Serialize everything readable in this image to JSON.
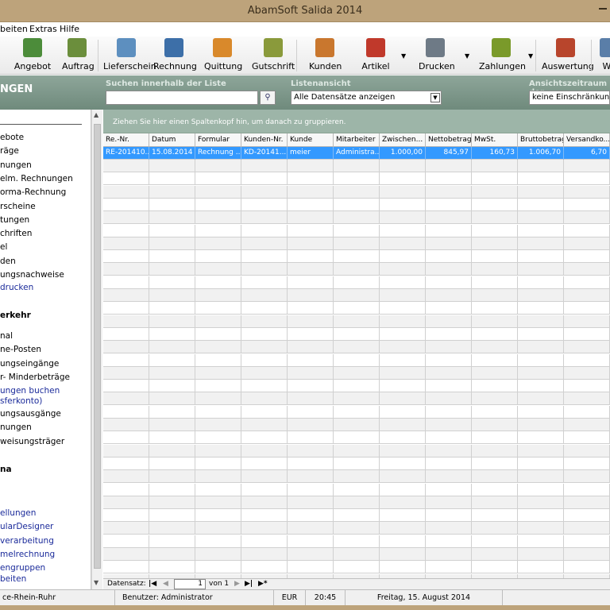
{
  "window": {
    "title": "AbamSoft Salida 2014"
  },
  "menu": [
    "beiten",
    "Extras",
    "Hilfe"
  ],
  "toolbar": [
    {
      "label": "Angebot",
      "icon": "offer-icon",
      "color": "#4c8c3a"
    },
    {
      "label": "Auftrag",
      "icon": "order-icon",
      "color": "#6b8e3c"
    },
    {
      "label": "Lieferschein",
      "icon": "delivery-note-icon",
      "color": "#5d8fbf"
    },
    {
      "label": "Rechnung",
      "icon": "invoice-icon",
      "color": "#3d6fa8"
    },
    {
      "label": "Quittung",
      "icon": "receipt-icon",
      "color": "#d9892b"
    },
    {
      "label": "Gutschrift",
      "icon": "credit-note-icon",
      "color": "#8a9a3b"
    },
    {
      "label": "Kunden",
      "icon": "customers-icon",
      "color": "#c9772e"
    },
    {
      "label": "Artikel",
      "icon": "articles-icon",
      "color": "#c0392b"
    },
    {
      "label": "Drucken",
      "icon": "printer-icon",
      "color": "#6e7a86"
    },
    {
      "label": "Zahlungen",
      "icon": "payments-icon",
      "color": "#7a9a2a"
    },
    {
      "label": "Auswertung",
      "icon": "analysis-icon",
      "color": "#b8452c"
    },
    {
      "label": "We",
      "icon": "more-icon",
      "color": "#5a7ea8"
    }
  ],
  "searchbar": {
    "heading": "NGEN",
    "search_label": "Suchen innerhalb der Liste",
    "search_value": "",
    "list_label": "Listenansicht",
    "list_value": "Alle Datensätze anzeigen",
    "period_label": "Ansichtszeitraum der",
    "period_value": "keine Einschränkung"
  },
  "sidebar": {
    "group1": [
      "ebote",
      "räge",
      "nungen",
      "elm. Rechnungen",
      "orma-Rechnung",
      "rscheine",
      "tungen",
      "chriften",
      "el",
      "den",
      "ungsnachweise"
    ],
    "group1_link": "drucken",
    "section2": "erkehr",
    "group2": [
      "nal",
      "ne-Posten",
      "ungseingänge",
      "r- Minderbeträge"
    ],
    "group2_link1": "ungen buchen",
    "group2_link2": "sferkonto)",
    "group2b": [
      "ungsausgänge",
      "nungen",
      "weisungsträger"
    ],
    "section3": "na",
    "group3": [
      "ellungen",
      "ularDesigner",
      "verarbeitung",
      "melrechnung",
      "engruppen",
      "beiten"
    ]
  },
  "grid": {
    "group_hint": "Ziehen Sie hier einen Spaltenkopf hin, um danach zu gruppieren.",
    "columns": [
      "Re.-Nr.",
      "Datum",
      "Formular",
      "Kunden-Nr.",
      "Kunde",
      "Mitarbeiter",
      "Zwischen...",
      "Nettobetrag",
      "MwSt.",
      "Bruttobetrag",
      "Versandko..."
    ],
    "rows": [
      [
        "RE-201410...",
        "15.08.2014",
        "Rechnung ...",
        "KD-20141...",
        "meier",
        "Administra...",
        "1.000,00",
        "845,97",
        "160,73",
        "1.006,70",
        "6,70"
      ]
    ],
    "empty_rows": 34
  },
  "navigator": {
    "label": "Datensatz:",
    "current": "1",
    "of_label": "von 1"
  },
  "status": {
    "company": "ce-Rhein-Ruhr",
    "user": "Benutzer: Administrator",
    "currency": "EUR",
    "time": "20:45",
    "date": "Freitag, 15. August 2014"
  }
}
